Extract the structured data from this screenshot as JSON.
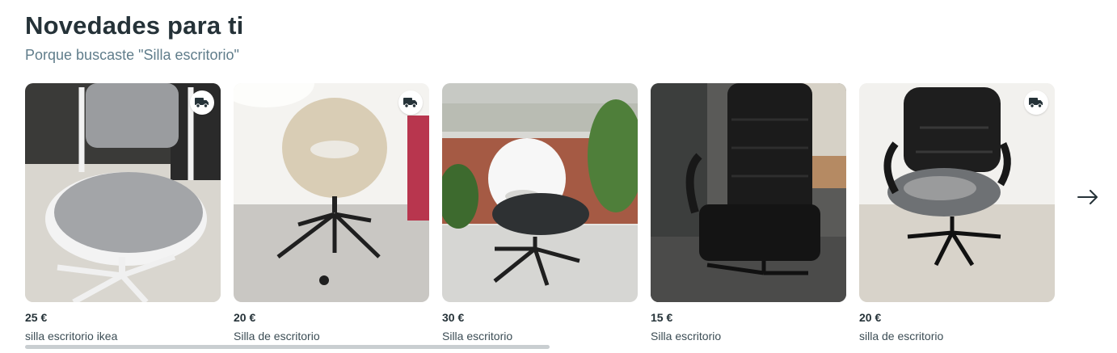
{
  "section": {
    "title": "Novedades para ti",
    "subtitle": "Porque buscaste \"Silla escritorio\""
  },
  "items": [
    {
      "price": "25 €",
      "title": "silla escritorio ikea",
      "shipping": true,
      "image": "grey-white-ikea-chair"
    },
    {
      "price": "20 €",
      "title": "Silla de escritorio",
      "shipping": true,
      "image": "beige-egg-chair"
    },
    {
      "price": "30 €",
      "title": "Silla escritorio",
      "shipping": false,
      "image": "white-chair-on-balcony"
    },
    {
      "price": "15 €",
      "title": "Silla escritorio",
      "shipping": false,
      "image": "black-leather-office-chair"
    },
    {
      "price": "20 €",
      "title": "silla de escritorio",
      "shipping": true,
      "image": "worn-black-office-chair"
    }
  ],
  "icons": {
    "shipping": "delivery-truck-icon",
    "next": "arrow-right-icon"
  },
  "colors": {
    "text": "#253238",
    "subtitle": "#607d8b",
    "scrollbar": "#c9ced1"
  }
}
